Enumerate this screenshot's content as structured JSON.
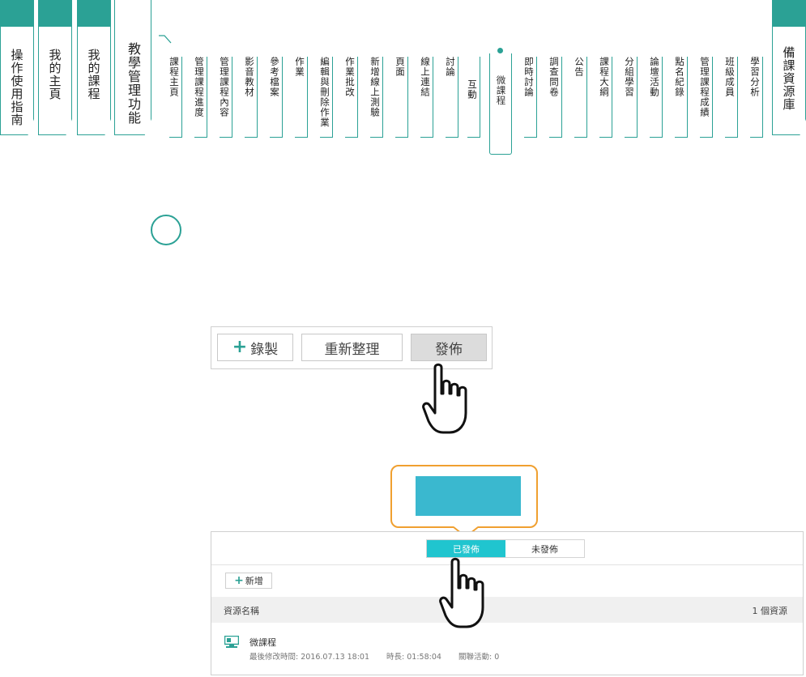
{
  "nav": {
    "main_tabs": [
      "操作使用指南",
      "我的主頁",
      "我的課程",
      "教學管理功能"
    ],
    "right_tab": "備課資源庫",
    "sub_tabs": [
      "課程主頁",
      "管理課程進度",
      "管理課程內容",
      "影音教材",
      "參考檔案",
      "作業",
      "編輯與刪除作業",
      "作業批改",
      "新增線上測驗",
      "頁面",
      "線上連結",
      "討論",
      "互動",
      "微課程",
      "即時討論",
      "調查問卷",
      "公告",
      "課程大綱",
      "分組學習",
      "論壇活動",
      "點名紀錄",
      "管理課程成績",
      "班級成員",
      "學習分析"
    ],
    "active_sub_tab": "微課程"
  },
  "toolbar": {
    "record_label": "錄製",
    "refresh_label": "重新整理",
    "publish_label": "發佈"
  },
  "panel": {
    "seg_published": "已發佈",
    "seg_unpublished": "未發佈",
    "add_label": "新增",
    "col_name": "資源名稱",
    "count": "1 個資源",
    "item": {
      "title": "微課程",
      "modified": "最後修改時間: 2016.07.13 18:01",
      "duration": "時長: 01:58:04",
      "related": "關聯活動: 0"
    }
  },
  "icons": [
    "plus-icon",
    "hand-pointer-icon",
    "microcourse-icon"
  ],
  "colors": {
    "accent": "#2ba195",
    "highlight": "#20c5cf",
    "bubble_border": "#f0a030",
    "bubble_fill": "#3ab8cf"
  }
}
